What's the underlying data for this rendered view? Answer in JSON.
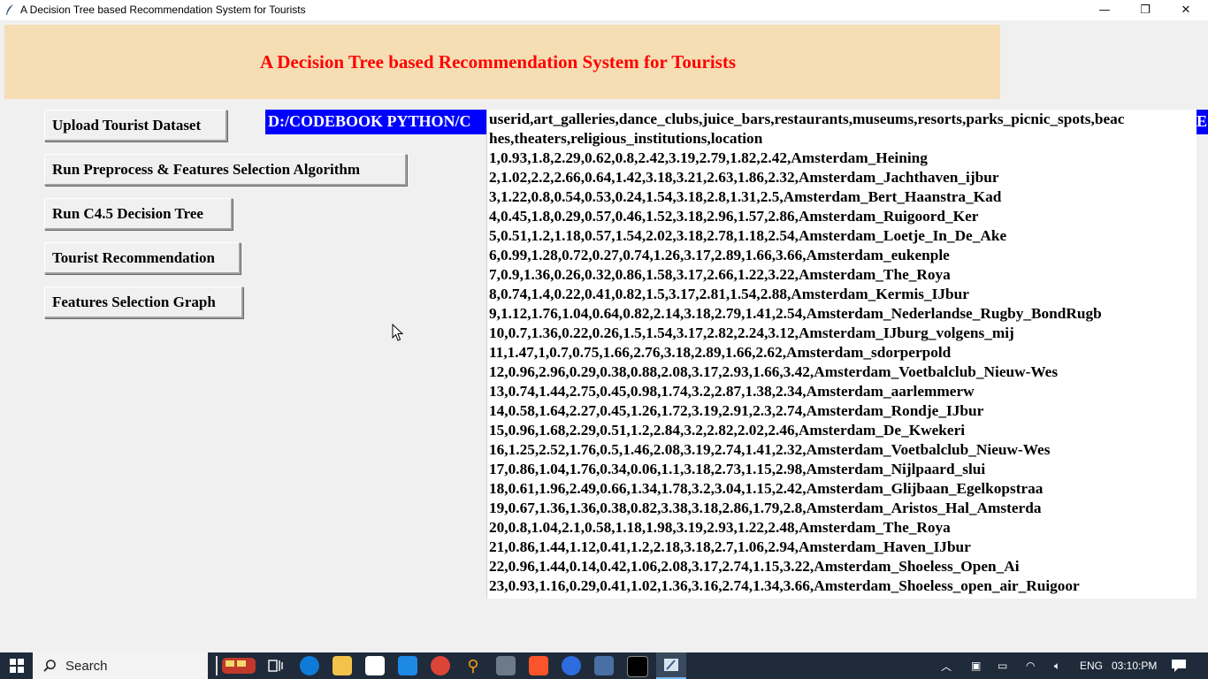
{
  "window": {
    "title": "A Decision Tree based Recommendation System for Tourists",
    "minimize_icon": "—",
    "maximize_icon": "❐",
    "close_icon": "✕"
  },
  "banner": {
    "title": "A Decision Tree based Recommendation System for Tourists"
  },
  "buttons": {
    "upload": "Upload Tourist Dataset",
    "preprocess": "Run Preprocess & Features Selection Algorithm",
    "c45": "Run C4.5 Decision Tree",
    "recommend": "Tourist Recommendation",
    "graph": "Features Selection Graph"
  },
  "path_label": "D:/CODEBOOK PYTHON/C",
  "path_label_overflow": "E",
  "output_lines": [
    "userid,art_galleries,dance_clubs,juice_bars,restaurants,museums,resorts,parks_picnic_spots,beac",
    "hes,theaters,religious_institutions,location",
    "1,0.93,1.8,2.29,0.62,0.8,2.42,3.19,2.79,1.82,2.42,Amsterdam_Heining",
    "2,1.02,2.2,2.66,0.64,1.42,3.18,3.21,2.63,1.86,2.32,Amsterdam_Jachthaven_ijbur",
    "3,1.22,0.8,0.54,0.53,0.24,1.54,3.18,2.8,1.31,2.5,Amsterdam_Bert_Haanstra_Kad",
    "4,0.45,1.8,0.29,0.57,0.46,1.52,3.18,2.96,1.57,2.86,Amsterdam_Ruigoord_Ker",
    "5,0.51,1.2,1.18,0.57,1.54,2.02,3.18,2.78,1.18,2.54,Amsterdam_Loetje_In_De_Ake",
    "6,0.99,1.28,0.72,0.27,0.74,1.26,3.17,2.89,1.66,3.66,Amsterdam_eukenple",
    "7,0.9,1.36,0.26,0.32,0.86,1.58,3.17,2.66,1.22,3.22,Amsterdam_The_Roya",
    "8,0.74,1.4,0.22,0.41,0.82,1.5,3.17,2.81,1.54,2.88,Amsterdam_Kermis_IJbur",
    "9,1.12,1.76,1.04,0.64,0.82,2.14,3.18,2.79,1.41,2.54,Amsterdam_Nederlandse_Rugby_BondRugb",
    "10,0.7,1.36,0.22,0.26,1.5,1.54,3.17,2.82,2.24,3.12,Amsterdam_IJburg_volgens_mij",
    "11,1.47,1,0.7,0.75,1.66,2.76,3.18,2.89,1.66,2.62,Amsterdam_sdorperpold",
    "12,0.96,2.96,0.29,0.38,0.88,2.08,3.17,2.93,1.66,3.42,Amsterdam_Voetbalclub_Nieuw-Wes",
    "13,0.74,1.44,2.75,0.45,0.98,1.74,3.2,2.87,1.38,2.34,Amsterdam_aarlemmerw",
    "14,0.58,1.64,2.27,0.45,1.26,1.72,3.19,2.91,2.3,2.74,Amsterdam_Rondje_IJbur",
    "15,0.96,1.68,2.29,0.51,1.2,2.84,3.2,2.82,2.02,2.46,Amsterdam_De_Kwekeri",
    "16,1.25,2.52,1.76,0.5,1.46,2.08,3.19,2.74,1.41,2.32,Amsterdam_Voetbalclub_Nieuw-Wes",
    "17,0.86,1.04,1.76,0.34,0.06,1.1,3.18,2.73,1.15,2.98,Amsterdam_Nijlpaard_slui",
    "18,0.61,1.96,2.49,0.66,1.34,1.78,3.2,3.04,1.15,2.42,Amsterdam_Glijbaan_Egelkopstraa",
    "19,0.67,1.36,1.36,0.38,0.82,3.38,3.18,2.86,1.79,2.8,Amsterdam_Aristos_Hal_Amsterda",
    "20,0.8,1.04,2.1,0.58,1.18,1.98,3.19,2.93,1.22,2.48,Amsterdam_The_Roya",
    "21,0.86,1.44,1.12,0.41,1.2,2.18,3.18,2.7,1.06,2.94,Amsterdam_Haven_IJbur",
    "22,0.96,1.44,0.14,0.42,1.06,2.08,3.17,2.74,1.15,3.22,Amsterdam_Shoeless_Open_Ai",
    "23,0.93,1.16,0.29,0.41,1.02,1.36,3.16,2.74,1.34,3.66,Amsterdam_Shoeless_open_air_Ruigoor"
  ],
  "taskbar": {
    "search_placeholder": "Search",
    "language": "ENG",
    "time": "03:10:PM"
  },
  "colors": {
    "banner_bg": "#f5deb3",
    "banner_text": "#ff0000",
    "path_bg": "#0000ff",
    "taskbar_bg": "#1f2b3a"
  }
}
